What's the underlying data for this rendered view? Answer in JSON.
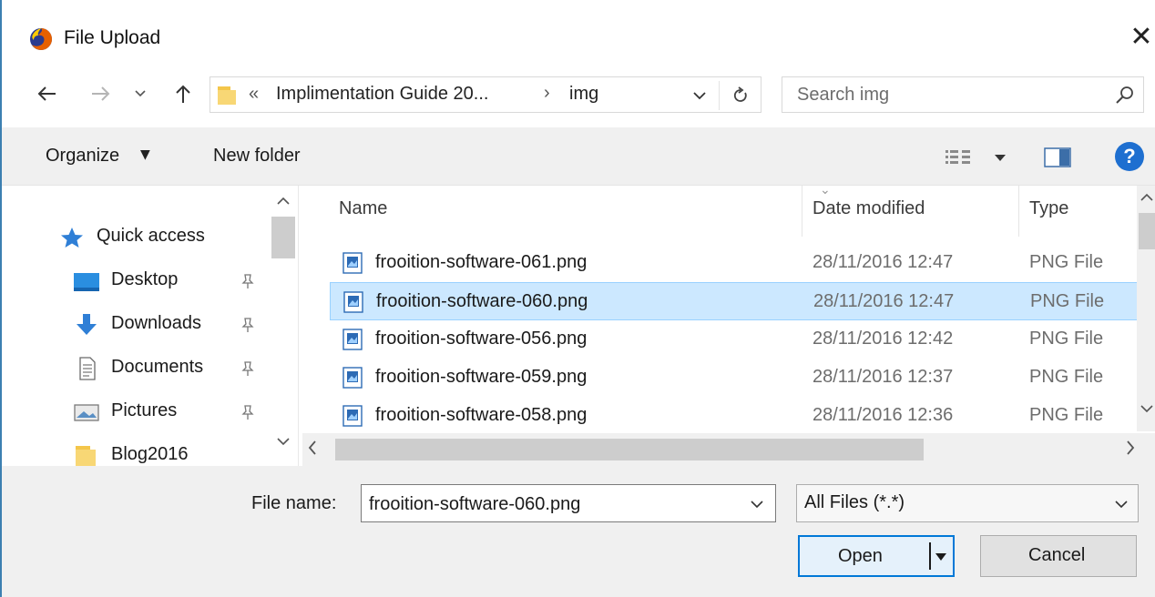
{
  "window": {
    "title": "File Upload",
    "close_glyph": "✕"
  },
  "address": {
    "chevrons": "«",
    "crumb1": "Implimentation Guide 20...",
    "separator": "›",
    "crumb2": "img"
  },
  "search": {
    "placeholder": "Search img"
  },
  "toolbar": {
    "organize_label": "Organize",
    "organize_caret": "▼",
    "new_folder_label": "New folder",
    "help_label": "?"
  },
  "nav_pane": {
    "items": [
      {
        "label": "Quick access",
        "icon": "star-icon",
        "pinned": false
      },
      {
        "label": "Desktop",
        "icon": "desktop-icon",
        "pinned": true
      },
      {
        "label": "Downloads",
        "icon": "downloads-icon",
        "pinned": true
      },
      {
        "label": "Documents",
        "icon": "documents-icon",
        "pinned": true
      },
      {
        "label": "Pictures",
        "icon": "pictures-icon",
        "pinned": true
      },
      {
        "label": "Blog2016",
        "icon": "folder-icon",
        "pinned": false
      }
    ]
  },
  "file_list": {
    "columns": {
      "name": "Name",
      "date": "Date modified",
      "type": "Type"
    },
    "rows": [
      {
        "name": "frooition-software-061.png",
        "date": "28/11/2016 12:47",
        "type": "PNG File",
        "selected": false
      },
      {
        "name": "frooition-software-060.png",
        "date": "28/11/2016 12:47",
        "type": "PNG File",
        "selected": true
      },
      {
        "name": "frooition-software-056.png",
        "date": "28/11/2016 12:42",
        "type": "PNG File",
        "selected": false
      },
      {
        "name": "frooition-software-059.png",
        "date": "28/11/2016 12:37",
        "type": "PNG File",
        "selected": false
      },
      {
        "name": "frooition-software-058.png",
        "date": "28/11/2016 12:36",
        "type": "PNG File",
        "selected": false
      }
    ]
  },
  "bottom": {
    "file_name_label": "File name:",
    "file_name_value": "frooition-software-060.png",
    "file_type_value": "All Files (*.*)",
    "open_label": "Open",
    "cancel_label": "Cancel"
  },
  "colors": {
    "selection_bg": "#cce8ff",
    "selection_border": "#99d1ff",
    "accent": "#0078d7",
    "help_blue": "#1e6fd0",
    "folder_yellow": "#f4c64a"
  }
}
